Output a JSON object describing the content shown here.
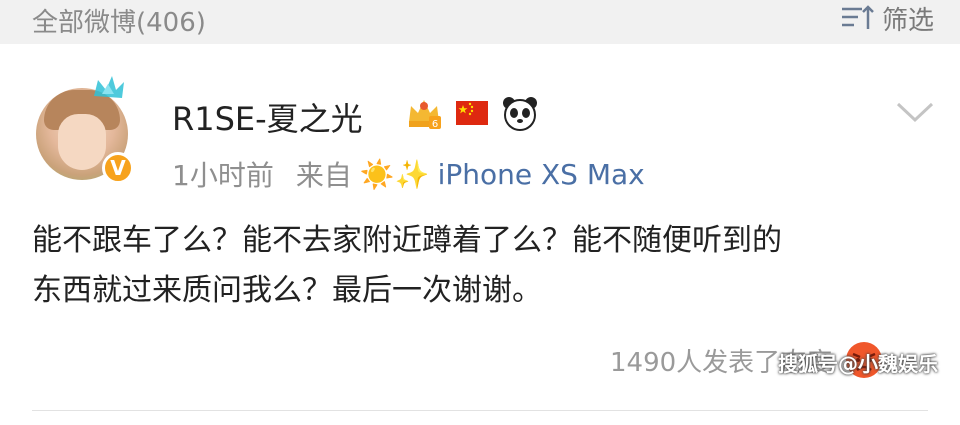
{
  "header": {
    "all_posts_label": "全部微博(406)",
    "filter_label": "筛选"
  },
  "post": {
    "username": "R1SE-夏之光",
    "verified_badge": "V",
    "badges": [
      "crown-level-6-icon",
      "china-flag-icon",
      "panda-icon"
    ],
    "crown_level": "6",
    "time": "1小时前",
    "from_label": "来自",
    "source_emoji": "☀️✨",
    "device": "iPhone XS Max",
    "content_line1": "能不跟车了么？能不去家附近蹲着了么？能不随便听到的",
    "content_line2": "东西就过来质问我么？最后一次谢谢。",
    "reaction_text": "1490人发表了态度",
    "reaction_icon": "angry-face-icon"
  },
  "watermark": "搜狐号@小魏娱乐",
  "colors": {
    "header_bg": "#f1f1f1",
    "link_blue": "#4a6fa5",
    "verified_orange": "#f7a21c",
    "angry_red": "#f0572b"
  }
}
